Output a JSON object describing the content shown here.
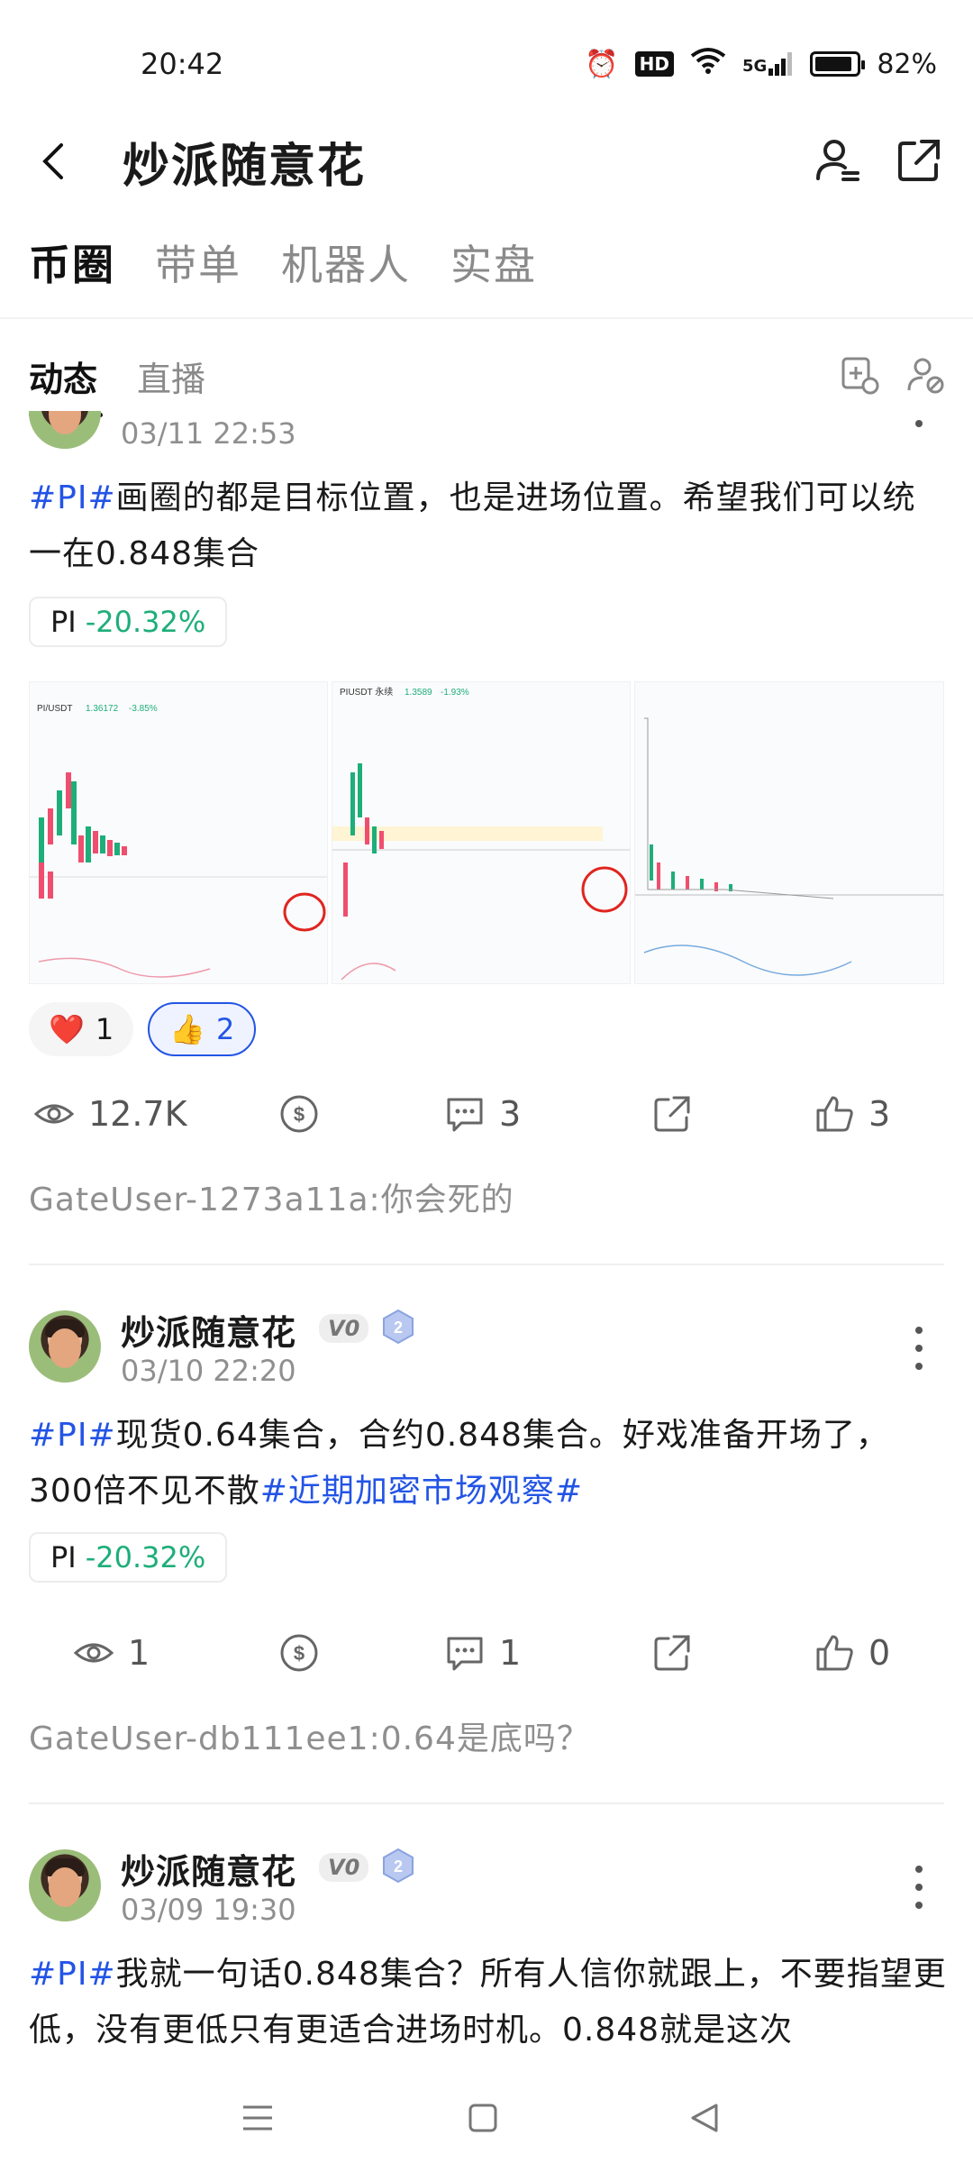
{
  "status_bar": {
    "time": "20:42",
    "battery": "82%",
    "network": "5G"
  },
  "header": {
    "title": "炒派随意花"
  },
  "main_tabs": [
    {
      "label": "币圈"
    },
    {
      "label": "带单"
    },
    {
      "label": "机器人"
    },
    {
      "label": "实盘"
    }
  ],
  "sub_tabs": [
    {
      "label": "动态"
    },
    {
      "label": "直播"
    }
  ],
  "posts": [
    {
      "time": "03/11 22:53",
      "text_tag": "#PI#",
      "text": "画圈的都是目标位置，也是进场位置。希望我们可以统一在0.848集合",
      "coin": "PI",
      "coin_change": "-20.32%",
      "reactions": [
        {
          "emoji": "❤️",
          "count": "1"
        },
        {
          "emoji": "👍",
          "count": "2"
        }
      ],
      "views": "12.7K",
      "comments": "3",
      "likes": "3",
      "comment_preview": "GateUser-1273a11a:你会死的"
    },
    {
      "author": "炒派随意花",
      "vip": "V0",
      "level": "2",
      "time": "03/10 22:20",
      "text_tag": "#PI#",
      "text": "现货0.64集合，合约0.848集合。好戏准备开场了，300倍不见不散",
      "text_tag2": "#近期加密市场观察#",
      "coin": "PI",
      "coin_change": "-20.32%",
      "views": "1",
      "comments": "1",
      "likes": "0",
      "comment_preview": "GateUser-db111ee1:0.64是底吗？"
    },
    {
      "author": "炒派随意花",
      "vip": "V0",
      "level": "2",
      "time": "03/09 19:30",
      "text_tag": "#PI#",
      "text": "我就一句话0.848集合？所有人信你就跟上，不要指望更低，没有更低只有更适合进场时机。0.848就是这次"
    }
  ],
  "charts": [
    {
      "pair": "PI/USDT",
      "price": "1.36172",
      "change": "-3.85%"
    },
    {
      "pair": "PIUSDT 永续",
      "price": "1.3589",
      "change": "-1.93%"
    },
    {
      "pair": "",
      "price": "",
      "change": ""
    }
  ],
  "colors": {
    "accent": "#2354e6",
    "down_green": "#1eae7a",
    "text": "#1a1a1a",
    "muted": "#8f8f8f"
  }
}
